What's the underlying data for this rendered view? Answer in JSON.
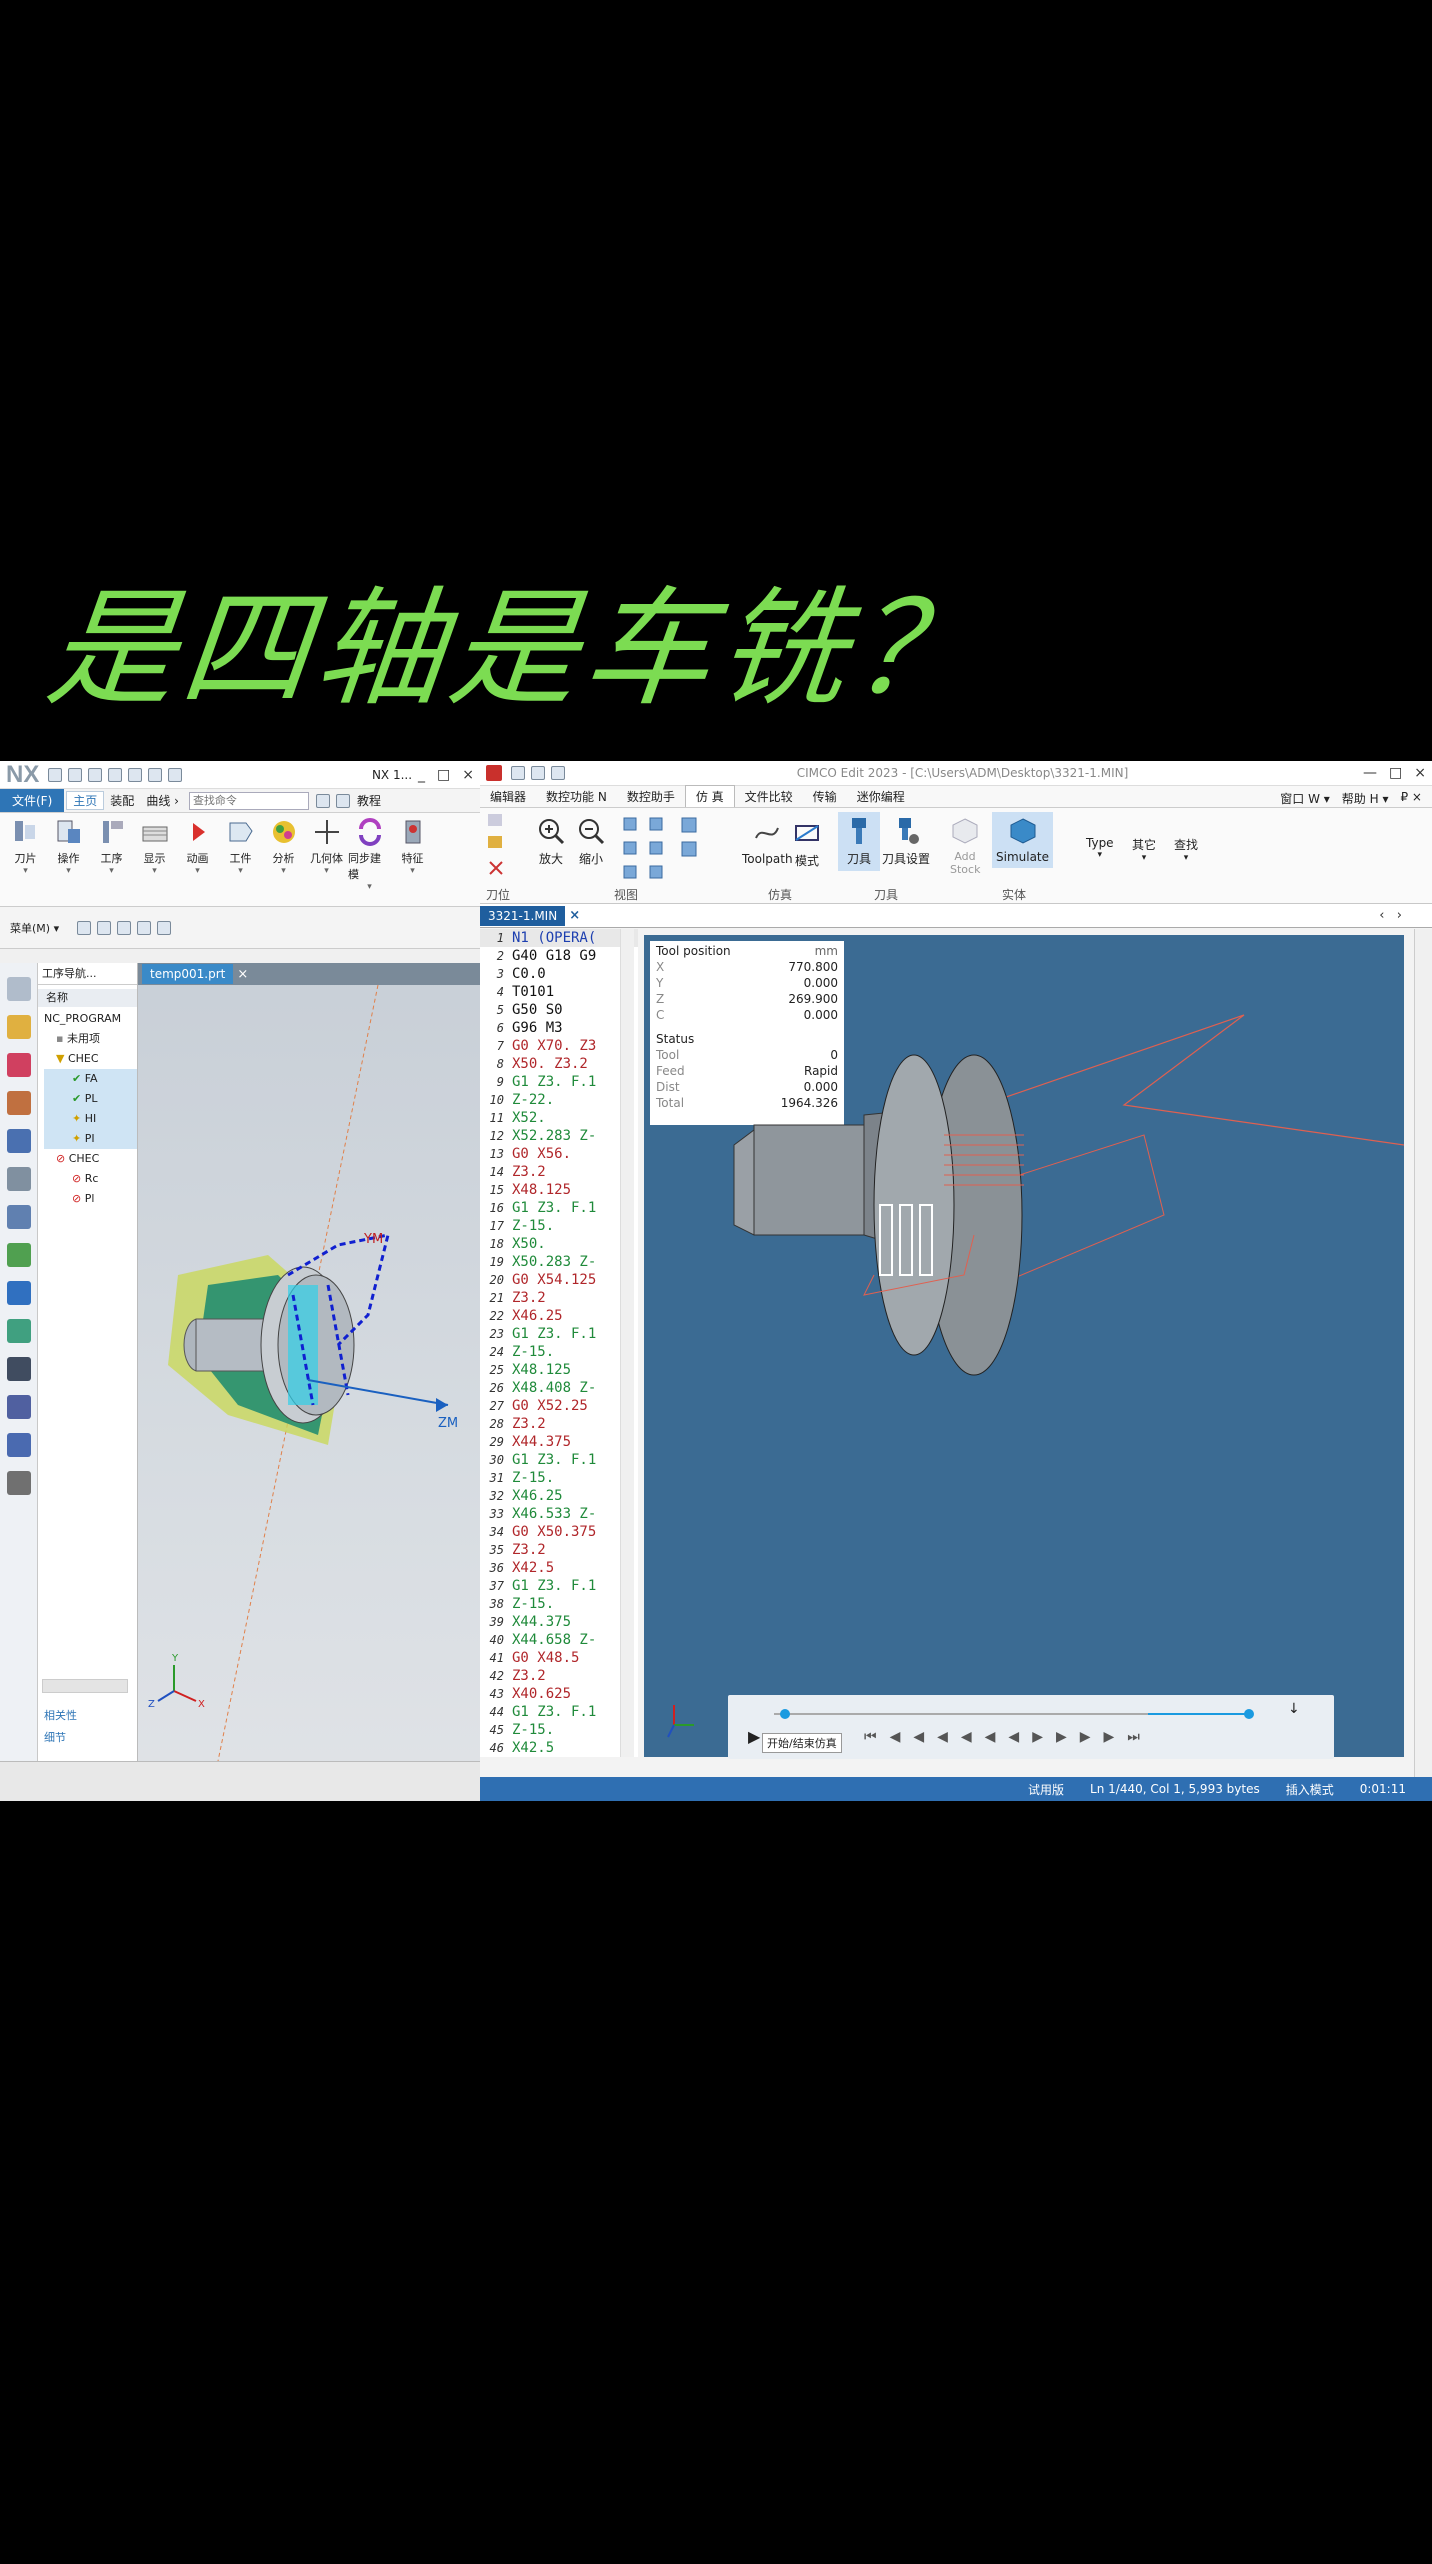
{
  "headline": "是四轴是车铣？",
  "nx": {
    "logo": "NX",
    "title": "NX 1...",
    "window_controls": [
      "_",
      "□",
      "×"
    ],
    "menu": {
      "file": "文件(F)",
      "tabs": [
        "主页",
        "装配",
        "曲线 ›"
      ],
      "search_placeholder": "查找命令",
      "tutorial": "教程"
    },
    "ribbon": [
      {
        "label": "刀片",
        "icon": "insert-icon"
      },
      {
        "label": "操作",
        "icon": "operation-icon"
      },
      {
        "label": "工序",
        "icon": "process-icon"
      },
      {
        "label": "显示",
        "icon": "display-icon"
      },
      {
        "label": "动画",
        "icon": "animation-icon"
      },
      {
        "label": "工件",
        "icon": "workpiece-icon"
      },
      {
        "label": "分析",
        "icon": "analysis-icon"
      },
      {
        "label": "几何体",
        "icon": "geometry-icon"
      },
      {
        "label": "同步建模",
        "icon": "sync-modeling-icon"
      },
      {
        "label": "特征",
        "icon": "feature-icon"
      }
    ],
    "selection_bar": {
      "menu": "菜单(M) ▾"
    },
    "navigator": {
      "title": "工序导航...",
      "column": "名称",
      "items": [
        "NC_PROGRAM",
        "未用项",
        "CHEC",
        "FA",
        "PL",
        "HI",
        "PI",
        "CHEC",
        "Rc",
        "Pl"
      ],
      "footer": [
        "相关性",
        "细节"
      ]
    },
    "doc_tab": "temp001.prt",
    "axes": {
      "zm": "ZM",
      "ym": "YM"
    },
    "triad": {
      "x": "X",
      "y": "Y",
      "z": "Z"
    }
  },
  "cimco": {
    "title": "CIMCO Edit 2023 - [C:\\Users\\ADM\\Desktop\\3321-1.MIN]",
    "window_controls": [
      "—",
      "□",
      "×"
    ],
    "menu_tabs": [
      "编辑器",
      "数控功能 N",
      "数控助手",
      "仿 真",
      "文件比较",
      "传输",
      "迷你编程"
    ],
    "menu_right": [
      "窗口 W ▾",
      "帮助 H ▾",
      "₽ ×"
    ],
    "ribbon": {
      "zoom_in": "放大",
      "zoom_out": "缩小",
      "toolpath": "Toolpath",
      "mode": "模式",
      "tool": "刀具",
      "tool_settings": "刀具设置",
      "add_stock": "Add Stock",
      "simulate": "Simulate",
      "type": "Type",
      "other": "其它",
      "find": "查找",
      "groups": [
        "刀位",
        "视图",
        "仿真",
        "刀具",
        "实体"
      ]
    },
    "doc_tab": "3321-1.MIN",
    "code": [
      {
        "n": "1",
        "t": "N1 (OPERA(",
        "c": "#1d3fb0"
      },
      {
        "n": "2",
        "t": "G40 G18 G9",
        "c": "#111"
      },
      {
        "n": "3",
        "t": "C0.0",
        "c": "#111"
      },
      {
        "n": "4",
        "t": "T0101",
        "c": "#111"
      },
      {
        "n": "5",
        "t": "G50 S0",
        "c": "#111"
      },
      {
        "n": "6",
        "t": "G96 M3",
        "c": "#111"
      },
      {
        "n": "7",
        "t": "G0 X70. Z3",
        "c": "#b0262a"
      },
      {
        "n": "8",
        "t": "X50. Z3.2",
        "c": "#b0262a"
      },
      {
        "n": "9",
        "t": "G1 Z3. F.1",
        "c": "#1f8a3a"
      },
      {
        "n": "10",
        "t": "Z-22.",
        "c": "#1f8a3a"
      },
      {
        "n": "11",
        "t": "X52.",
        "c": "#1f8a3a"
      },
      {
        "n": "12",
        "t": "X52.283 Z-",
        "c": "#1f8a3a"
      },
      {
        "n": "13",
        "t": "G0 X56.",
        "c": "#b0262a"
      },
      {
        "n": "14",
        "t": "Z3.2",
        "c": "#b0262a"
      },
      {
        "n": "15",
        "t": "X48.125",
        "c": "#b0262a"
      },
      {
        "n": "16",
        "t": "G1 Z3. F.1",
        "c": "#1f8a3a"
      },
      {
        "n": "17",
        "t": "Z-15.",
        "c": "#1f8a3a"
      },
      {
        "n": "18",
        "t": "X50.",
        "c": "#1f8a3a"
      },
      {
        "n": "19",
        "t": "X50.283 Z-",
        "c": "#1f8a3a"
      },
      {
        "n": "20",
        "t": "G0 X54.125",
        "c": "#b0262a"
      },
      {
        "n": "21",
        "t": "Z3.2",
        "c": "#b0262a"
      },
      {
        "n": "22",
        "t": "X46.25",
        "c": "#b0262a"
      },
      {
        "n": "23",
        "t": "G1 Z3. F.1",
        "c": "#1f8a3a"
      },
      {
        "n": "24",
        "t": "Z-15.",
        "c": "#1f8a3a"
      },
      {
        "n": "25",
        "t": "X48.125",
        "c": "#1f8a3a"
      },
      {
        "n": "26",
        "t": "X48.408 Z-",
        "c": "#1f8a3a"
      },
      {
        "n": "27",
        "t": "G0 X52.25",
        "c": "#b0262a"
      },
      {
        "n": "28",
        "t": "Z3.2",
        "c": "#b0262a"
      },
      {
        "n": "29",
        "t": "X44.375",
        "c": "#b0262a"
      },
      {
        "n": "30",
        "t": "G1 Z3. F.1",
        "c": "#1f8a3a"
      },
      {
        "n": "31",
        "t": "Z-15.",
        "c": "#1f8a3a"
      },
      {
        "n": "32",
        "t": "X46.25",
        "c": "#1f8a3a"
      },
      {
        "n": "33",
        "t": "X46.533 Z-",
        "c": "#1f8a3a"
      },
      {
        "n": "34",
        "t": "G0 X50.375",
        "c": "#b0262a"
      },
      {
        "n": "35",
        "t": "Z3.2",
        "c": "#b0262a"
      },
      {
        "n": "36",
        "t": "X42.5",
        "c": "#b0262a"
      },
      {
        "n": "37",
        "t": "G1 Z3. F.1",
        "c": "#1f8a3a"
      },
      {
        "n": "38",
        "t": "Z-15.",
        "c": "#1f8a3a"
      },
      {
        "n": "39",
        "t": "X44.375",
        "c": "#1f8a3a"
      },
      {
        "n": "40",
        "t": "X44.658 Z-",
        "c": "#1f8a3a"
      },
      {
        "n": "41",
        "t": "G0 X48.5",
        "c": "#b0262a"
      },
      {
        "n": "42",
        "t": "Z3.2",
        "c": "#b0262a"
      },
      {
        "n": "43",
        "t": "X40.625",
        "c": "#b0262a"
      },
      {
        "n": "44",
        "t": "G1 Z3. F.1",
        "c": "#1f8a3a"
      },
      {
        "n": "45",
        "t": "Z-15.",
        "c": "#1f8a3a"
      },
      {
        "n": "46",
        "t": "X42.5",
        "c": "#1f8a3a"
      }
    ],
    "tool_position": {
      "title": "Tool position",
      "unit": "mm",
      "rows": [
        {
          "k": "X",
          "v": "770.800"
        },
        {
          "k": "Y",
          "v": "0.000"
        },
        {
          "k": "Z",
          "v": "269.900"
        },
        {
          "k": "C",
          "v": "0.000"
        }
      ],
      "status_title": "Status",
      "status": [
        {
          "k": "Tool",
          "v": "0"
        },
        {
          "k": "Feed",
          "v": "Rapid"
        },
        {
          "k": "Dist",
          "v": "0.000"
        },
        {
          "k": "Total",
          "v": "1964.326"
        }
      ]
    },
    "player": {
      "tooltip": "开始/结束仿真",
      "progress": 0.0
    },
    "status_bar": [
      "试用版",
      "Ln 1/440, Col 1, 5,993 bytes",
      "插入模式",
      "0:01:11"
    ],
    "colors": {
      "accent": "#2f6fb2",
      "viewport": "#3b6b93",
      "rapid": "#b0262a",
      "feed": "#1f8a3a"
    }
  }
}
